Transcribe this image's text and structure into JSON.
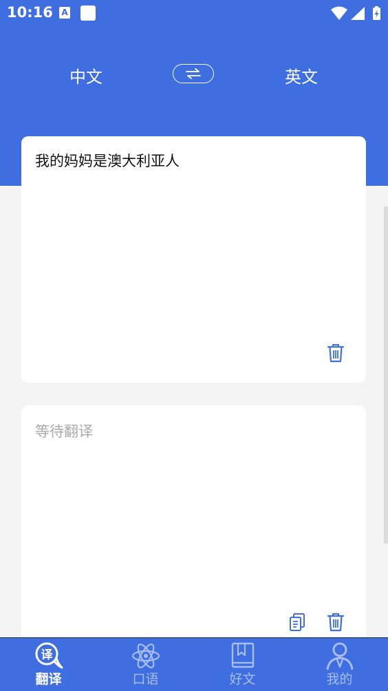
{
  "status_bar": {
    "time": "10:16",
    "notification_icon_letter": "A",
    "icons": [
      "a-notification-icon",
      "square-notification-icon",
      "wifi-icon",
      "signal-icon",
      "battery-icon"
    ]
  },
  "language_bar": {
    "source": "中文",
    "target": "英文",
    "swap_icon": "swap-arrows-icon"
  },
  "input_card": {
    "text": "我的妈妈是澳大利亚人",
    "delete_icon": "trash-icon"
  },
  "output_card": {
    "placeholder": "等待翻译",
    "copy_icon": "copy-icon",
    "delete_icon": "trash-icon"
  },
  "bottom_nav": {
    "items": [
      {
        "label": "翻译",
        "icon": "translate-icon",
        "icon_text": "译",
        "active": true
      },
      {
        "label": "口语",
        "icon": "atom-icon",
        "active": false
      },
      {
        "label": "好文",
        "icon": "book-icon",
        "active": false
      },
      {
        "label": "我的",
        "icon": "profile-icon",
        "active": false
      }
    ]
  },
  "colors": {
    "primary": "#3e6edf",
    "background": "#f4f4f4",
    "card": "#ffffff",
    "placeholder": "#a9a9a9",
    "nav_inactive": "#a9bdf0"
  }
}
